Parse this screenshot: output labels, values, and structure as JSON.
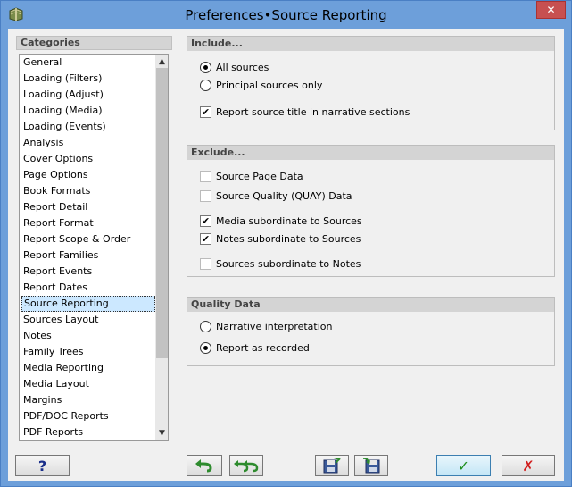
{
  "window": {
    "title": "Preferences•Source Reporting",
    "close_glyph": "✕"
  },
  "categories": {
    "header": "Categories",
    "items": [
      "General",
      "Loading (Filters)",
      "Loading (Adjust)",
      "Loading (Media)",
      "Loading (Events)",
      "Analysis",
      "Cover Options",
      "Page Options",
      "Book Formats",
      "Report Detail",
      "Report Format",
      "Report Scope & Order",
      "Report Families",
      "Report Events",
      "Report Dates",
      "Source Reporting",
      "Sources Layout",
      "Notes",
      "Family Trees",
      "Media Reporting",
      "Media Layout",
      "Margins",
      "PDF/DOC Reports",
      "PDF Reports"
    ],
    "selected": "Source Reporting",
    "scroll_up_glyph": "▲",
    "scroll_down_glyph": "▼"
  },
  "include": {
    "header": "Include...",
    "all_sources": "All sources",
    "principal_sources": "Principal sources only",
    "report_title": "Report source title in narrative sections",
    "selected_radio": "all_sources",
    "report_title_checked": true
  },
  "exclude": {
    "header": "Exclude...",
    "source_page_data": "Source Page Data",
    "source_quality": "Source Quality (QUAY) Data",
    "media_subordinate": "Media subordinate to Sources",
    "notes_subordinate": "Notes subordinate to Sources",
    "sources_subordinate": "Sources subordinate to Notes",
    "checked": {
      "source_page_data": false,
      "source_quality": false,
      "media_subordinate": true,
      "notes_subordinate": true,
      "sources_subordinate": false
    }
  },
  "quality": {
    "header": "Quality Data",
    "narrative": "Narrative interpretation",
    "as_recorded": "Report as recorded",
    "selected_radio": "as_recorded"
  },
  "buttons": {
    "help": "?",
    "ok_glyph": "✓",
    "cancel_glyph": "✗"
  },
  "colors": {
    "title_bar": "#6d9fda",
    "close_button": "#c75050",
    "selection": "#cce8ff",
    "help_blue": "#1a2f8a",
    "undo_green": "#2e8b2e",
    "ok_green": "#1f8f1f",
    "cancel_red": "#d11c1c"
  },
  "icons": {
    "app": "book-icon",
    "undo": "undo-arrow-icon",
    "undo_all": "undo-all-arrows-icon",
    "save": "floppy-save-icon",
    "load": "floppy-load-icon"
  }
}
